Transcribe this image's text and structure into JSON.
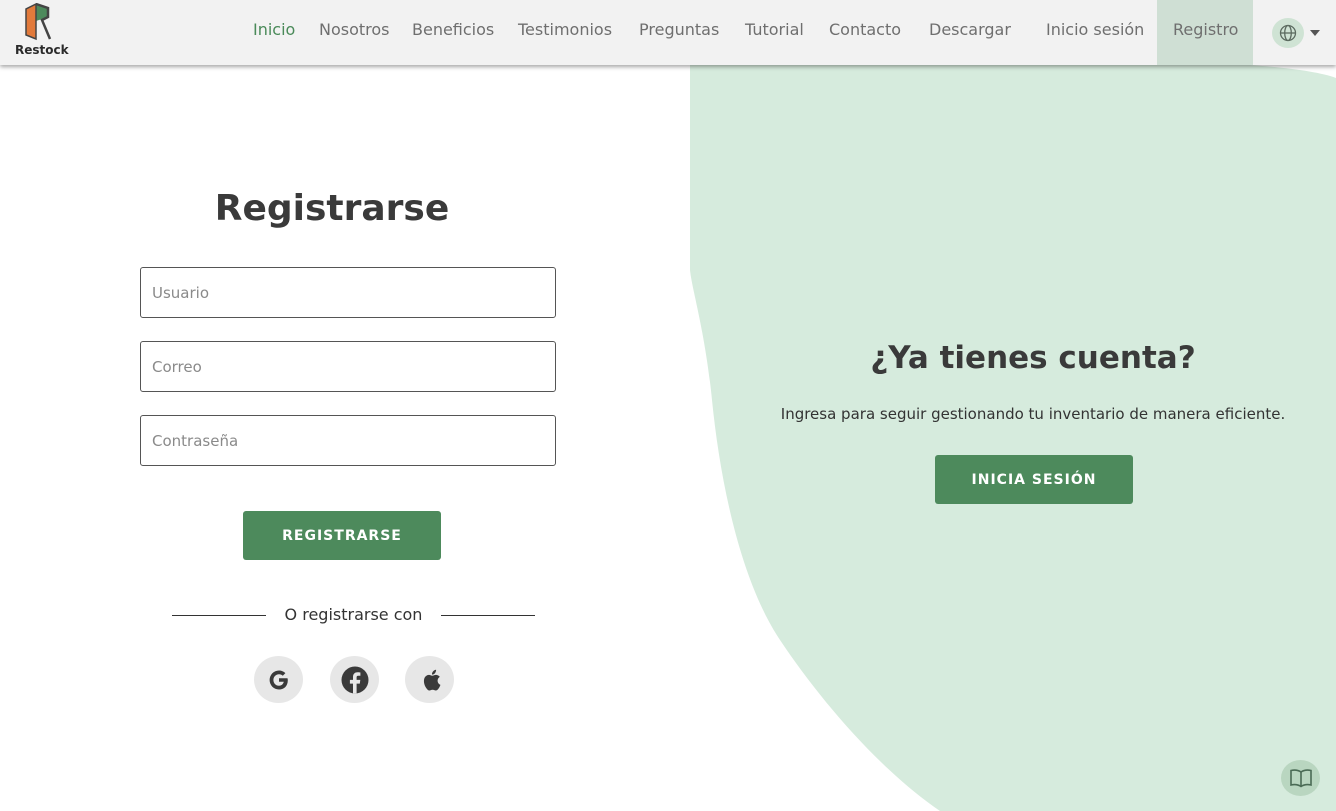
{
  "brand": {
    "name": "Restock"
  },
  "nav": {
    "items": [
      {
        "label": "Inicio",
        "active": true
      },
      {
        "label": "Nosotros"
      },
      {
        "label": "Beneficios"
      },
      {
        "label": "Testimonios"
      },
      {
        "label": "Preguntas"
      },
      {
        "label": "Tutorial"
      },
      {
        "label": "Contacto"
      },
      {
        "label": "Descargar"
      }
    ],
    "login": "Inicio sesión",
    "separator": "|",
    "register": "Registro",
    "language_icon": "globe-icon"
  },
  "register_form": {
    "title": "Registrarse",
    "username_placeholder": "Usuario",
    "email_placeholder": "Correo",
    "password_placeholder": "Contraseña",
    "submit": "REGISTRARSE",
    "divider": "O registrarse con",
    "social": [
      "google-icon",
      "facebook-icon",
      "apple-icon"
    ]
  },
  "login_panel": {
    "title": "¿Ya tienes cuenta?",
    "subtitle": "Ingresa para seguir gestionando tu inventario de manera eficiente.",
    "button": "INICIA SESIÓN"
  },
  "colors": {
    "accent": "#4d8a5c",
    "panel": "#d6ebdd",
    "nav_bg": "#f2f2f2",
    "active_link": "#4a8a59"
  }
}
